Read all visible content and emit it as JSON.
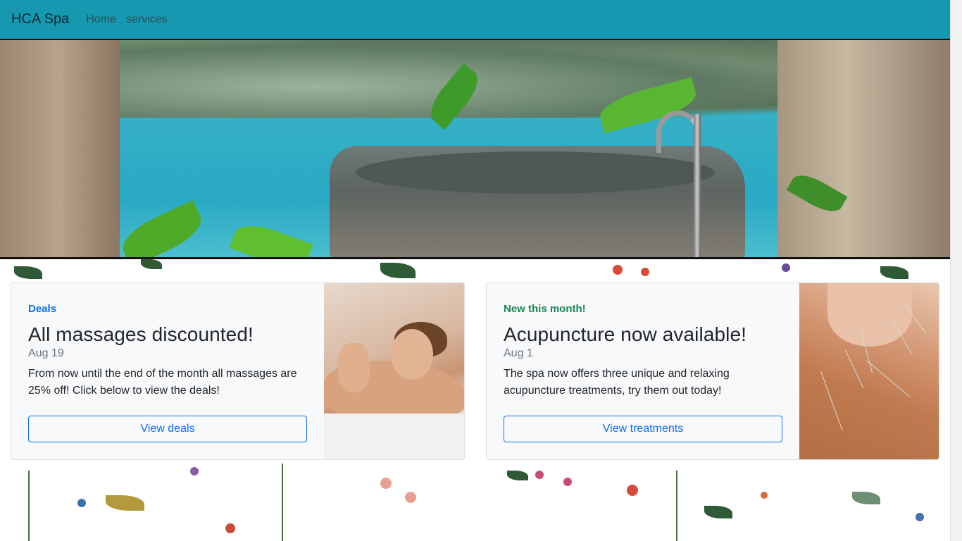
{
  "navbar": {
    "brand": "HCA Spa",
    "links": [
      "Home",
      "services"
    ]
  },
  "hero": {
    "image": "stone-bathtub-grotto"
  },
  "cards": [
    {
      "tag": "Deals",
      "tag_color": "#0d6efd",
      "title": "All massages discounted!",
      "date": "Aug 19",
      "text": "From now until the end of the month all massages are 25% off! Click below to view the deals!",
      "button": "View deals",
      "image": "massage-photo"
    },
    {
      "tag": "New this month!",
      "tag_color": "#198754",
      "title": "Acupuncture now available!",
      "date": "Aug 1",
      "text": "The spa now offers three unique and relaxing acupuncture treatments, try them out today!",
      "button": "View treatments",
      "image": "acupuncture-photo"
    }
  ],
  "colors": {
    "navbar": "#1698b0",
    "primary": "#0d6efd",
    "success": "#198754"
  }
}
